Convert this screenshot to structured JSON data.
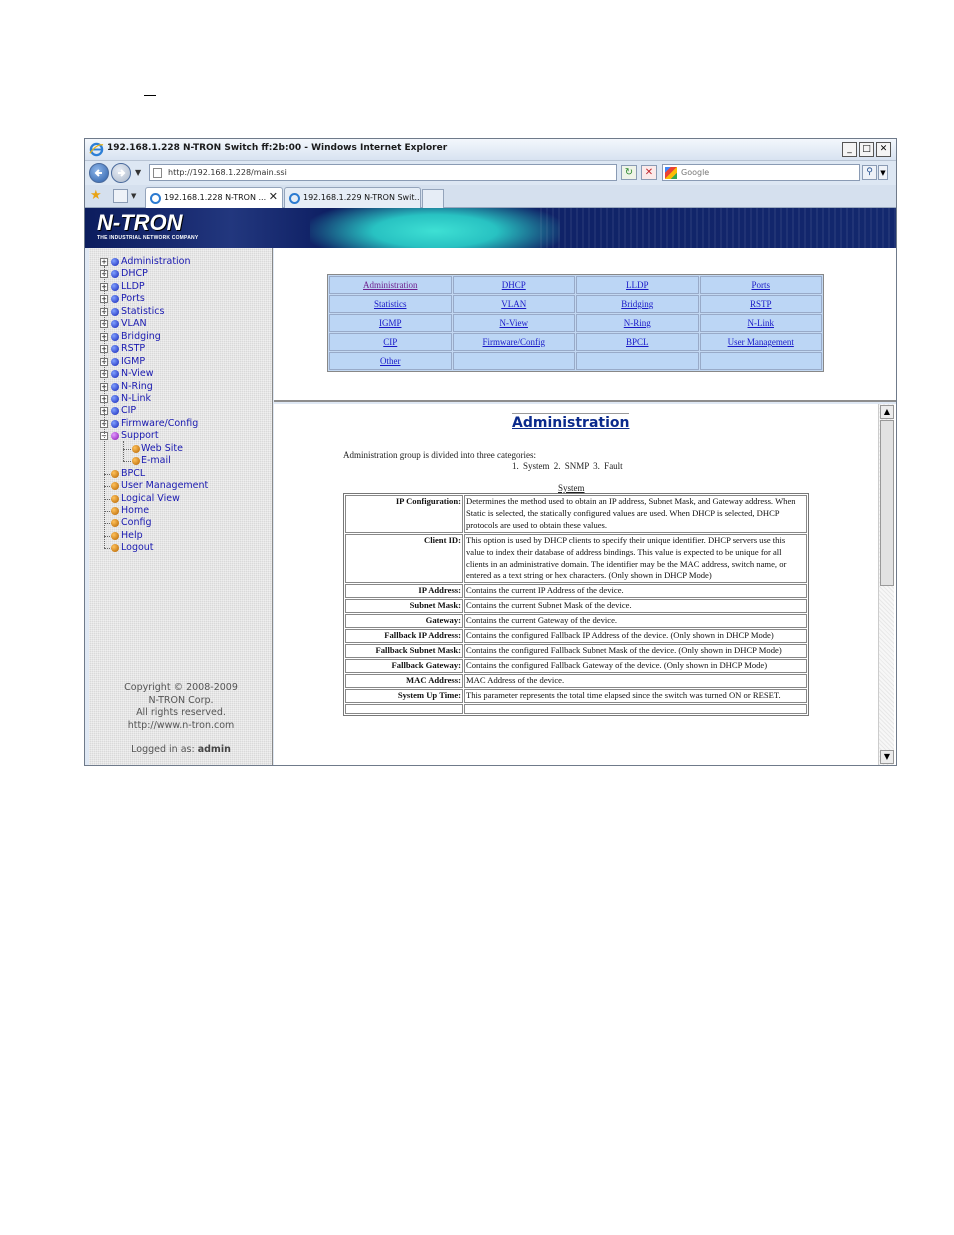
{
  "window": {
    "title": "192.168.1.228 N-TRON Switch ff:2b:00 - Windows Internet Explorer",
    "controls": {
      "minimize": "_",
      "maximize": "□",
      "close": "✕"
    }
  },
  "address_bar": {
    "url": "http://192.168.1.228/main.ssi",
    "search_placeholder": "Google"
  },
  "tabs": [
    {
      "label": "192.168.1.228 N-TRON ...",
      "active": true,
      "close": "✕"
    },
    {
      "label": "192.168.1.229 N-TRON Swit...",
      "active": false
    }
  ],
  "banner": {
    "logo": "N-TRON",
    "tagline": "THE INDUSTRIAL NETWORK COMPANY"
  },
  "sidebar": {
    "items": [
      {
        "label": "Administration",
        "dot": "blue",
        "expander": "+"
      },
      {
        "label": "DHCP",
        "dot": "blue",
        "expander": "+"
      },
      {
        "label": "LLDP",
        "dot": "blue",
        "expander": "+"
      },
      {
        "label": "Ports",
        "dot": "blue",
        "expander": "+"
      },
      {
        "label": "Statistics",
        "dot": "blue",
        "expander": "+"
      },
      {
        "label": "VLAN",
        "dot": "blue",
        "expander": "+"
      },
      {
        "label": "Bridging",
        "dot": "blue",
        "expander": "+"
      },
      {
        "label": "RSTP",
        "dot": "blue",
        "expander": "+"
      },
      {
        "label": "IGMP",
        "dot": "blue",
        "expander": "+"
      },
      {
        "label": "N-View",
        "dot": "blue",
        "expander": "+"
      },
      {
        "label": "N-Ring",
        "dot": "blue",
        "expander": "+"
      },
      {
        "label": "N-Link",
        "dot": "blue",
        "expander": "+"
      },
      {
        "label": "CIP",
        "dot": "blue",
        "expander": "+"
      },
      {
        "label": "Firmware/Config",
        "dot": "blue",
        "expander": "+"
      },
      {
        "label": "Support",
        "dot": "purple",
        "expander": "−"
      },
      {
        "label": "Web Site",
        "dot": "orange",
        "child": true
      },
      {
        "label": "E-mail",
        "dot": "orange",
        "child": true
      },
      {
        "label": "BPCL",
        "dot": "orange"
      },
      {
        "label": "User Management",
        "dot": "orange"
      },
      {
        "label": "Logical View",
        "dot": "orange"
      },
      {
        "label": "Home",
        "dot": "orange"
      },
      {
        "label": "Config",
        "dot": "orange"
      },
      {
        "label": "Help",
        "dot": "orange"
      },
      {
        "label": "Logout",
        "dot": "orange"
      }
    ],
    "footer": {
      "copyright": "Copyright © 2008-2009",
      "company": "N-TRON Corp.",
      "rights": "All rights reserved.",
      "website": "http://www.n-tron.com",
      "logged_in_label": "Logged in as:",
      "user": "admin"
    }
  },
  "categories": {
    "rows": [
      [
        "Administration",
        "DHCP",
        "LLDP",
        "Ports"
      ],
      [
        "Statistics",
        "VLAN",
        "Bridging",
        "RSTP"
      ],
      [
        "IGMP",
        "N-View",
        "N-Ring",
        "N-Link"
      ],
      [
        "CIP",
        "Firmware/Config",
        "BPCL",
        "User Management"
      ],
      [
        "Other",
        "",
        "",
        ""
      ]
    ]
  },
  "content": {
    "heading": "Administration",
    "intro": "Administration group is divided into three categories:",
    "categories_line": "1. System   2. SNMP   3. Fault",
    "section_title": "System",
    "rows": [
      {
        "label": "IP Configuration:",
        "desc": "Determines the method used to obtain an IP address, Subnet Mask, and Gateway address. When Static is selected, the statically configured values are used. When DHCP is selected, DHCP protocols are used to obtain these values."
      },
      {
        "label": "Client ID:",
        "desc": "This option is used by DHCP clients to specify their unique identifier. DHCP servers use this value to index their database of address bindings. This value is expected to be unique for all clients in an administrative domain. The identifier may be the MAC address, switch name, or entered as a text string or hex characters. (Only shown in DHCP Mode)"
      },
      {
        "label": "IP Address:",
        "desc": "Contains the current IP Address of the device."
      },
      {
        "label": "Subnet Mask:",
        "desc": "Contains the current Subnet Mask of the device."
      },
      {
        "label": "Gateway:",
        "desc": "Contains the current Gateway of the device."
      },
      {
        "label": "Fallback IP Address:",
        "desc": "Contains the configured Fallback IP Address of the device. (Only shown in DHCP Mode)"
      },
      {
        "label": "Fallback Subnet Mask:",
        "desc": "Contains the configured Fallback Subnet Mask of the device. (Only shown in DHCP Mode)"
      },
      {
        "label": "Fallback Gateway:",
        "desc": "Contains the configured Fallback Gateway of the device. (Only shown in DHCP Mode)"
      },
      {
        "label": "MAC Address:",
        "desc": "MAC Address of the device."
      },
      {
        "label": "System Up Time:",
        "desc": "This parameter represents the total time elapsed since the switch was turned ON or RESET."
      },
      {
        "label": "",
        "desc": ""
      }
    ]
  }
}
